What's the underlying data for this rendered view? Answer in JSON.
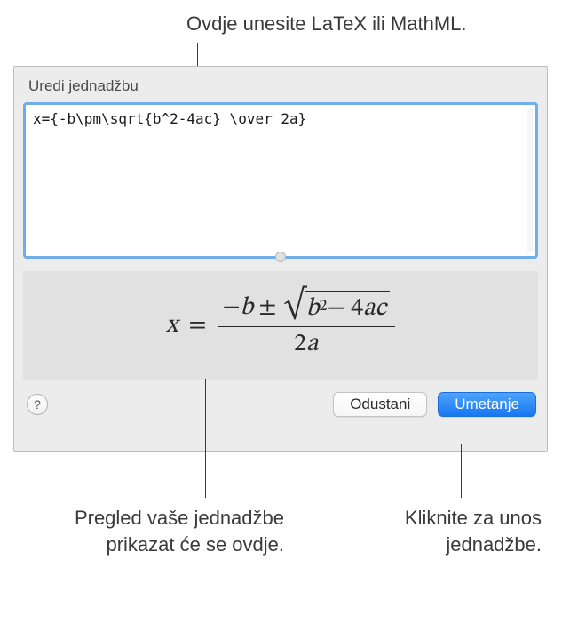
{
  "callouts": {
    "top": "Ovdje unesite LaTeX ili MathML.",
    "preview": "Pregled vaše jednadžbe prikazat će se ovdje.",
    "insert": "Kliknite za unos jednadžbe."
  },
  "dialog": {
    "title": "Uredi jednadžbu",
    "input_value": "x={-b\\pm\\sqrt{b^2-4ac} \\over 2a}"
  },
  "buttons": {
    "help": "?",
    "cancel": "Odustani",
    "insert": "Umetanje"
  },
  "equation": {
    "lhs": "x",
    "eq": "=",
    "minus": "−",
    "b": "b",
    "pm": "±",
    "sqrt_b": "b",
    "sqrt_exp": "2",
    "sqrt_minus": " − 4",
    "sqrt_a": "a",
    "sqrt_c": "c",
    "den_two": "2",
    "den_a": "a"
  }
}
